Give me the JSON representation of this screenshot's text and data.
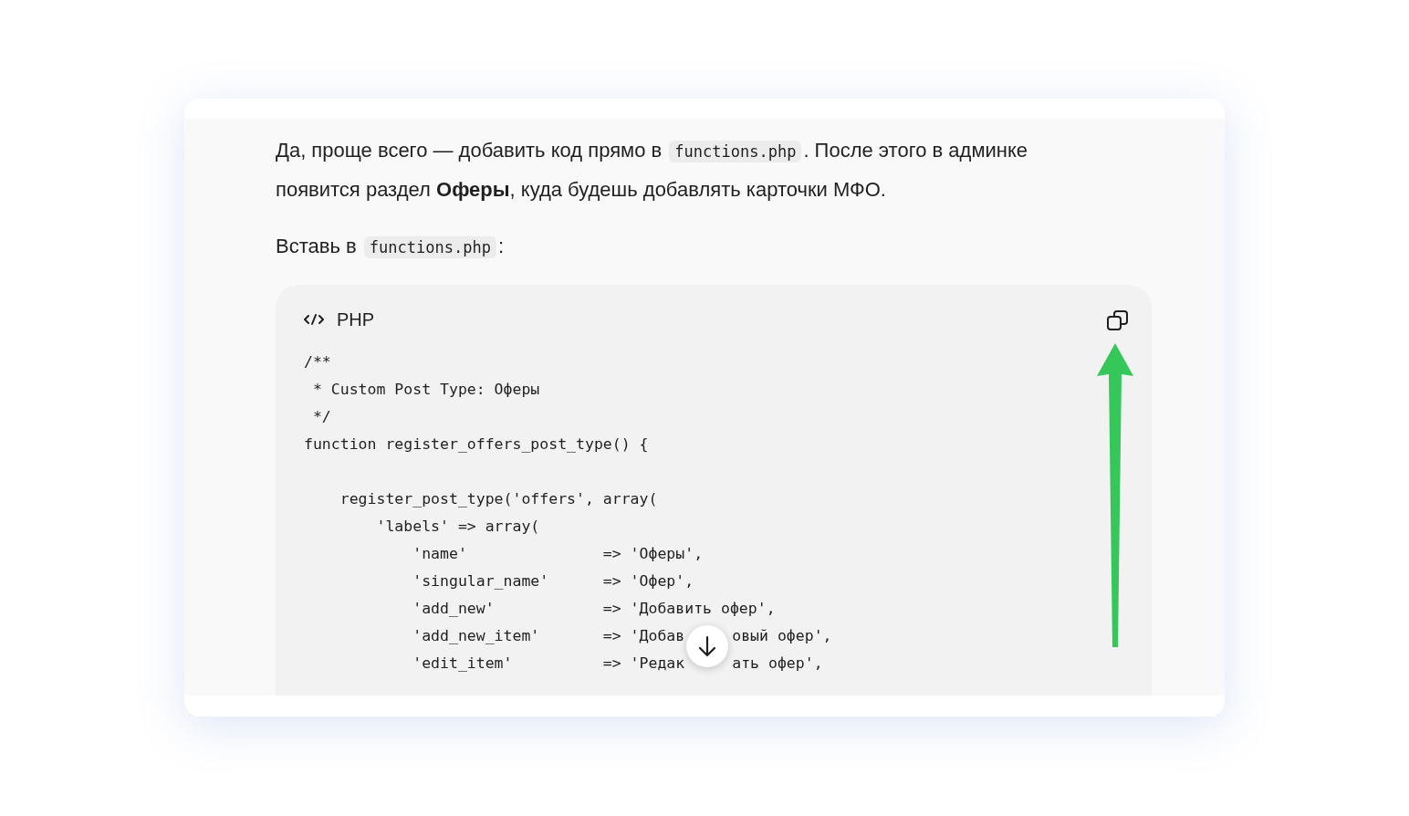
{
  "message": {
    "paragraphs": [
      {
        "segments": [
          {
            "kind": "text",
            "text": "Да, проще всего — добавить код прямо в "
          },
          {
            "kind": "code",
            "text": "functions.php"
          },
          {
            "kind": "text",
            "text": ". После этого в админке появится раздел **Оферы**, куда будешь добавлять карточки МФО."
          }
        ]
      },
      {
        "segments": [
          {
            "kind": "text",
            "text": "Вставь в "
          },
          {
            "kind": "code",
            "text": "functions.php"
          },
          {
            "kind": "text",
            "text": ":"
          }
        ]
      }
    ],
    "code_block": {
      "language": "PHP",
      "lines": [
        {
          "kind": "code",
          "parts": [
            "/**"
          ]
        },
        {
          "kind": "code",
          "parts": [
            " * Custom Post Type: Оферы"
          ]
        },
        {
          "kind": "code",
          "parts": [
            " */"
          ]
        },
        {
          "kind": "code",
          "parts": [
            "function register_offers_post_type() {"
          ]
        },
        {
          "kind": "blank"
        },
        {
          "kind": "code",
          "parts": [
            "    register_post_type('offers', array("
          ]
        },
        {
          "kind": "code",
          "parts": [
            "        'labels' => array("
          ]
        },
        {
          "kind": "code",
          "parts": [
            "            'name'               => 'Оферы',"
          ]
        },
        {
          "kind": "code",
          "parts": [
            "            'singular_name'      => 'Офер',"
          ]
        },
        {
          "kind": "code",
          "parts": [
            "            'add_new'            => 'Добавить офер',"
          ]
        },
        {
          "kind": "code",
          "parts": [
            "            'add_new_item'       => 'Добав",
            "овый офер',"
          ]
        },
        {
          "kind": "code",
          "parts": [
            "            'edit_item'          => 'Редак",
            "ать офер',"
          ]
        }
      ]
    }
  }
}
